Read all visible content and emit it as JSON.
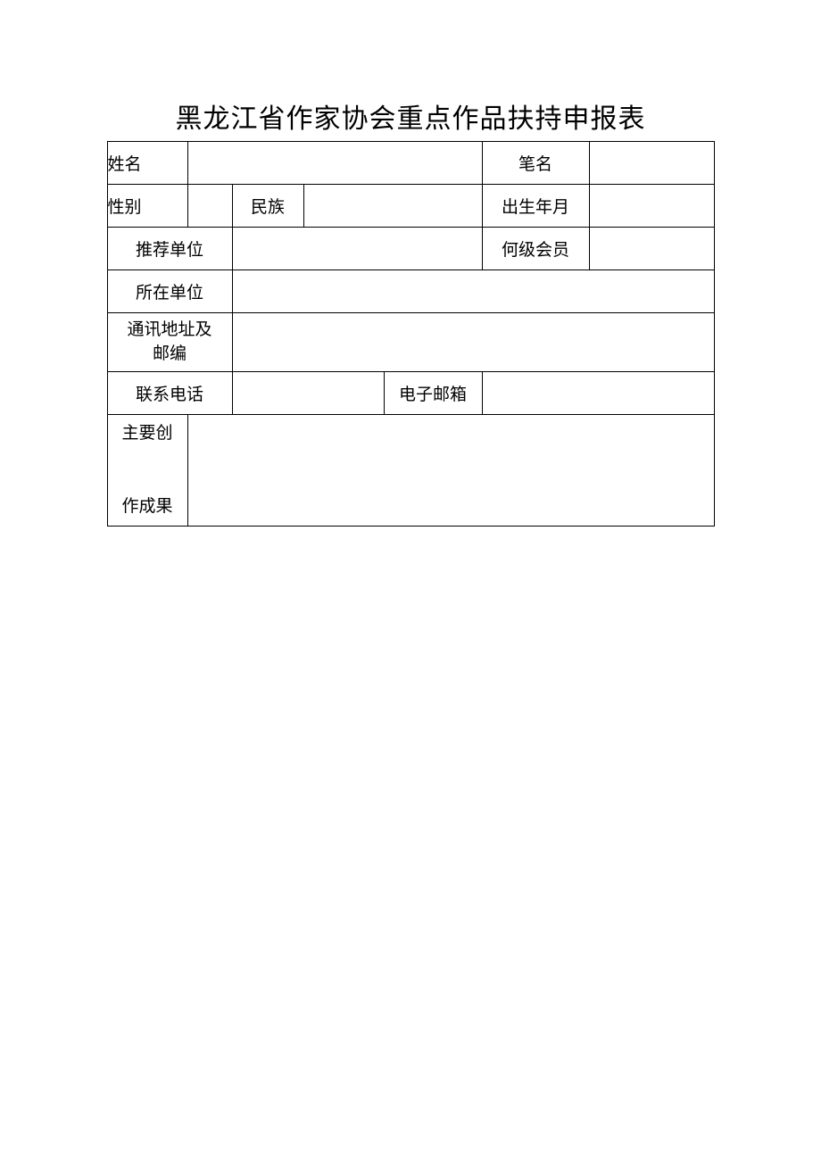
{
  "title": "黑龙江省作家协会重点作品扶持申报表",
  "fields": {
    "name_label": "姓名",
    "penname_label": "笔名",
    "gender_label": "性别",
    "ethnicity_label": "民族",
    "birth_label": "出生年月",
    "recommender_label": "推荐单位",
    "member_level_label": "何级会员",
    "affiliation_label": "所在单位",
    "address_label_line1": "通讯地址及",
    "address_label_line2": "邮编",
    "phone_label": "联系电话",
    "email_label": "电子邮箱",
    "achievements_label_line1": "主要创",
    "achievements_label_line2": "作成果",
    "name_value": "",
    "penname_value": "",
    "gender_value": "",
    "ethnicity_value": "",
    "birth_value": "",
    "recommender_value": "",
    "member_level_value": "",
    "affiliation_value": "",
    "address_value": "",
    "phone_value": "",
    "email_value": "",
    "achievements_value": ""
  }
}
